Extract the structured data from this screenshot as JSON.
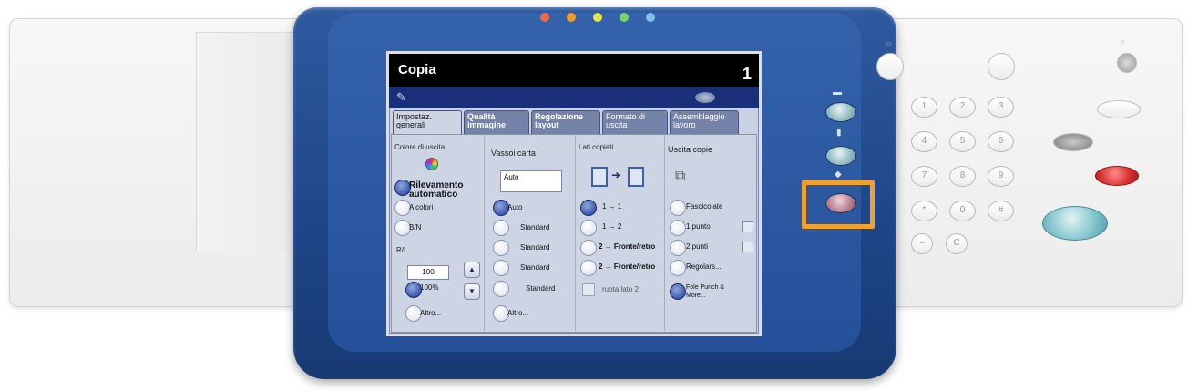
{
  "screen": {
    "title": "Copia",
    "counter": "1"
  },
  "tabs": [
    {
      "label": "Impostaz. generali",
      "active": true
    },
    {
      "label": "Qualità immagine",
      "active": false
    },
    {
      "label": "Regolazione layout",
      "active": false
    },
    {
      "label": "Formato di uscita",
      "active": false
    },
    {
      "label": "Assemblaggio lavoro",
      "active": false
    }
  ],
  "color": {
    "label": "Colore di uscita",
    "options": [
      "Rilevamento automatico",
      "A colori",
      "B/N"
    ],
    "selected_index": 0
  },
  "ridimensiona": {
    "label": "R/I",
    "value": "100",
    "options": [
      "100%",
      "Altro..."
    ],
    "selected_index": 0,
    "up_symbol": "▲",
    "down_symbol": "▼"
  },
  "vassoi": {
    "label": "Vassoi carta",
    "field_value": "Auto",
    "options": [
      "Auto",
      "Standard",
      "Standard",
      "Standard",
      "Standard",
      "Altro..."
    ],
    "selected_index": 0
  },
  "lati": {
    "label": "Lati copiati",
    "options": [
      "1 → 1",
      "1 → 2",
      "2 → Fronte/retro",
      "2 → Fronte/retro"
    ],
    "checkbox_label": "ruota lato 2",
    "selected_index": 0
  },
  "uscita": {
    "label": "Uscita copie",
    "options": [
      "Fascicolate",
      "1 punto",
      "2 punti",
      "Regolars...",
      "Fole Punch & More..."
    ],
    "selected_index": 4
  },
  "side_buttons": [
    "services-button",
    "job-status-button",
    "machine-status-button"
  ],
  "keypad": {
    "keys": [
      "1",
      "2",
      "3",
      "4",
      "5",
      "6",
      "7",
      "8",
      "9",
      "*",
      "0",
      "#"
    ],
    "clear": "C"
  },
  "colors": {
    "bezel": "#1e4586",
    "highlight": "#f0a02c",
    "start": "#6fb8c2",
    "stop": "#e0393b"
  }
}
